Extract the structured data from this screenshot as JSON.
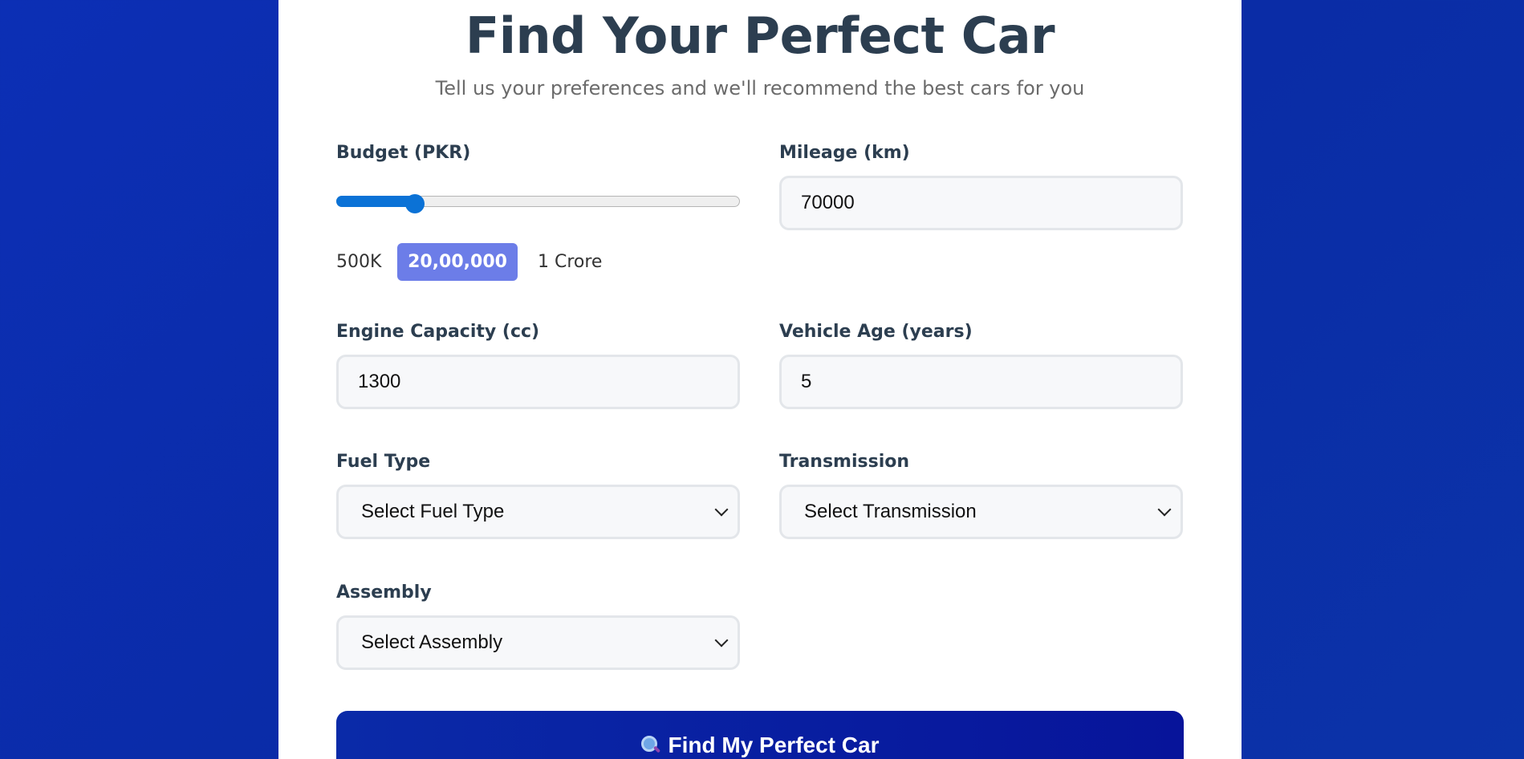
{
  "header": {
    "title": "Find Your Perfect Car",
    "subtitle": "Tell us your preferences and we'll recommend the best cars for you"
  },
  "form": {
    "budget": {
      "label": "Budget (PKR)",
      "min_label": "500K",
      "max_label": "1 Crore",
      "value_label": "20,00,000",
      "min": 500000,
      "max": 10000000,
      "value": 2000000
    },
    "mileage": {
      "label": "Mileage (km)",
      "value": "70000"
    },
    "engine_capacity": {
      "label": "Engine Capacity (cc)",
      "value": "1300"
    },
    "vehicle_age": {
      "label": "Vehicle Age (years)",
      "value": "5"
    },
    "fuel_type": {
      "label": "Fuel Type",
      "selected": "Select Fuel Type"
    },
    "transmission": {
      "label": "Transmission",
      "selected": "Select Transmission"
    },
    "assembly": {
      "label": "Assembly",
      "selected": "Select Assembly"
    },
    "submit": {
      "label": "Find My Perfect Car",
      "icon": "search-icon"
    }
  },
  "colors": {
    "background": "#0a2ba6",
    "accent": "#0b72d6",
    "badge": "#6c7de8",
    "button": "#07149a",
    "heading": "#2c3e50"
  }
}
